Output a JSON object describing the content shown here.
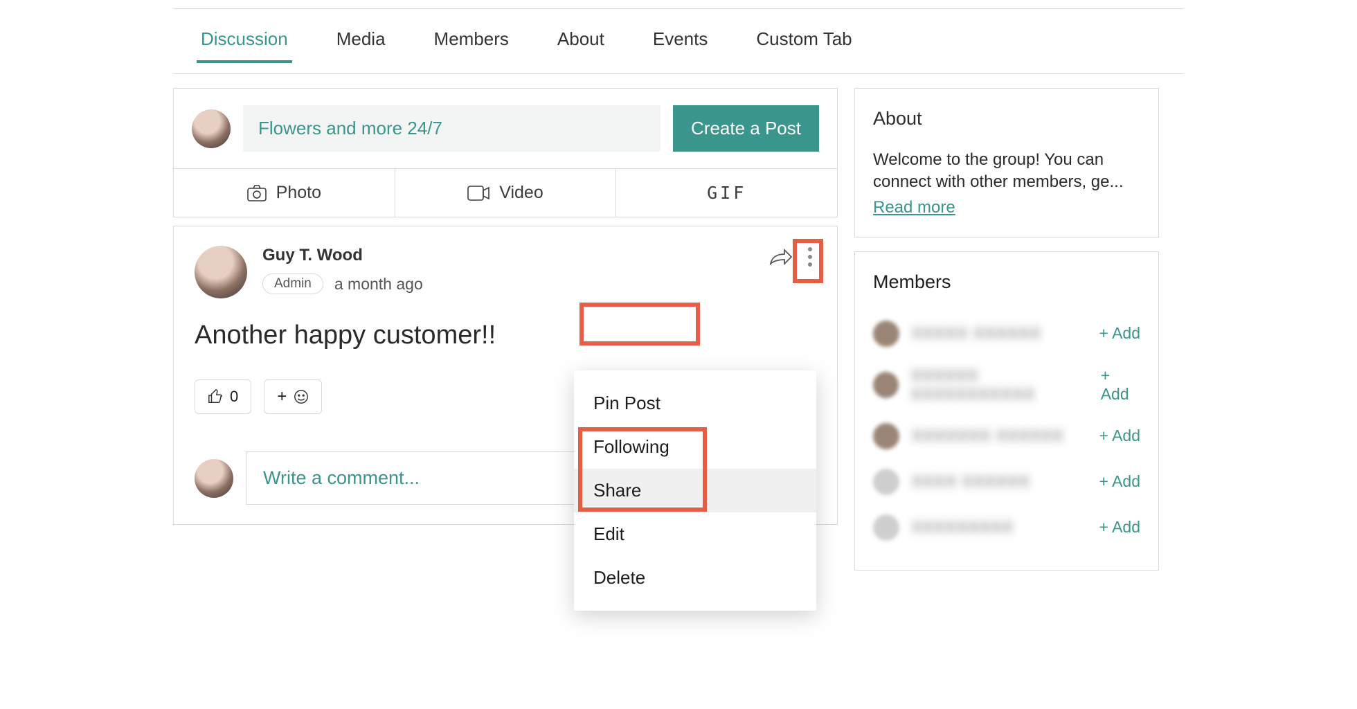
{
  "tabs": {
    "items": [
      "Discussion",
      "Media",
      "Members",
      "About",
      "Events",
      "Custom Tab"
    ],
    "active": 0
  },
  "composer": {
    "placeholder": "Flowers and more 24/7",
    "create_label": "Create a Post",
    "actions": {
      "photo": "Photo",
      "video": "Video",
      "gif": "GIF"
    }
  },
  "post": {
    "author": "Guy T. Wood",
    "role_badge": "Admin",
    "time": "a month ago",
    "body": "Another happy customer!!",
    "likes": "0",
    "menu": {
      "pin": "Pin Post",
      "following": "Following",
      "share": "Share",
      "edit": "Edit",
      "delete": "Delete"
    },
    "comment_placeholder": "Write a comment..."
  },
  "sidebar": {
    "about": {
      "title": "About",
      "text": "Welcome to the group! You can connect with other members, ge...",
      "read_more": "Read more"
    },
    "members": {
      "title": "Members",
      "add_label": "+ Add",
      "count": 5
    }
  }
}
